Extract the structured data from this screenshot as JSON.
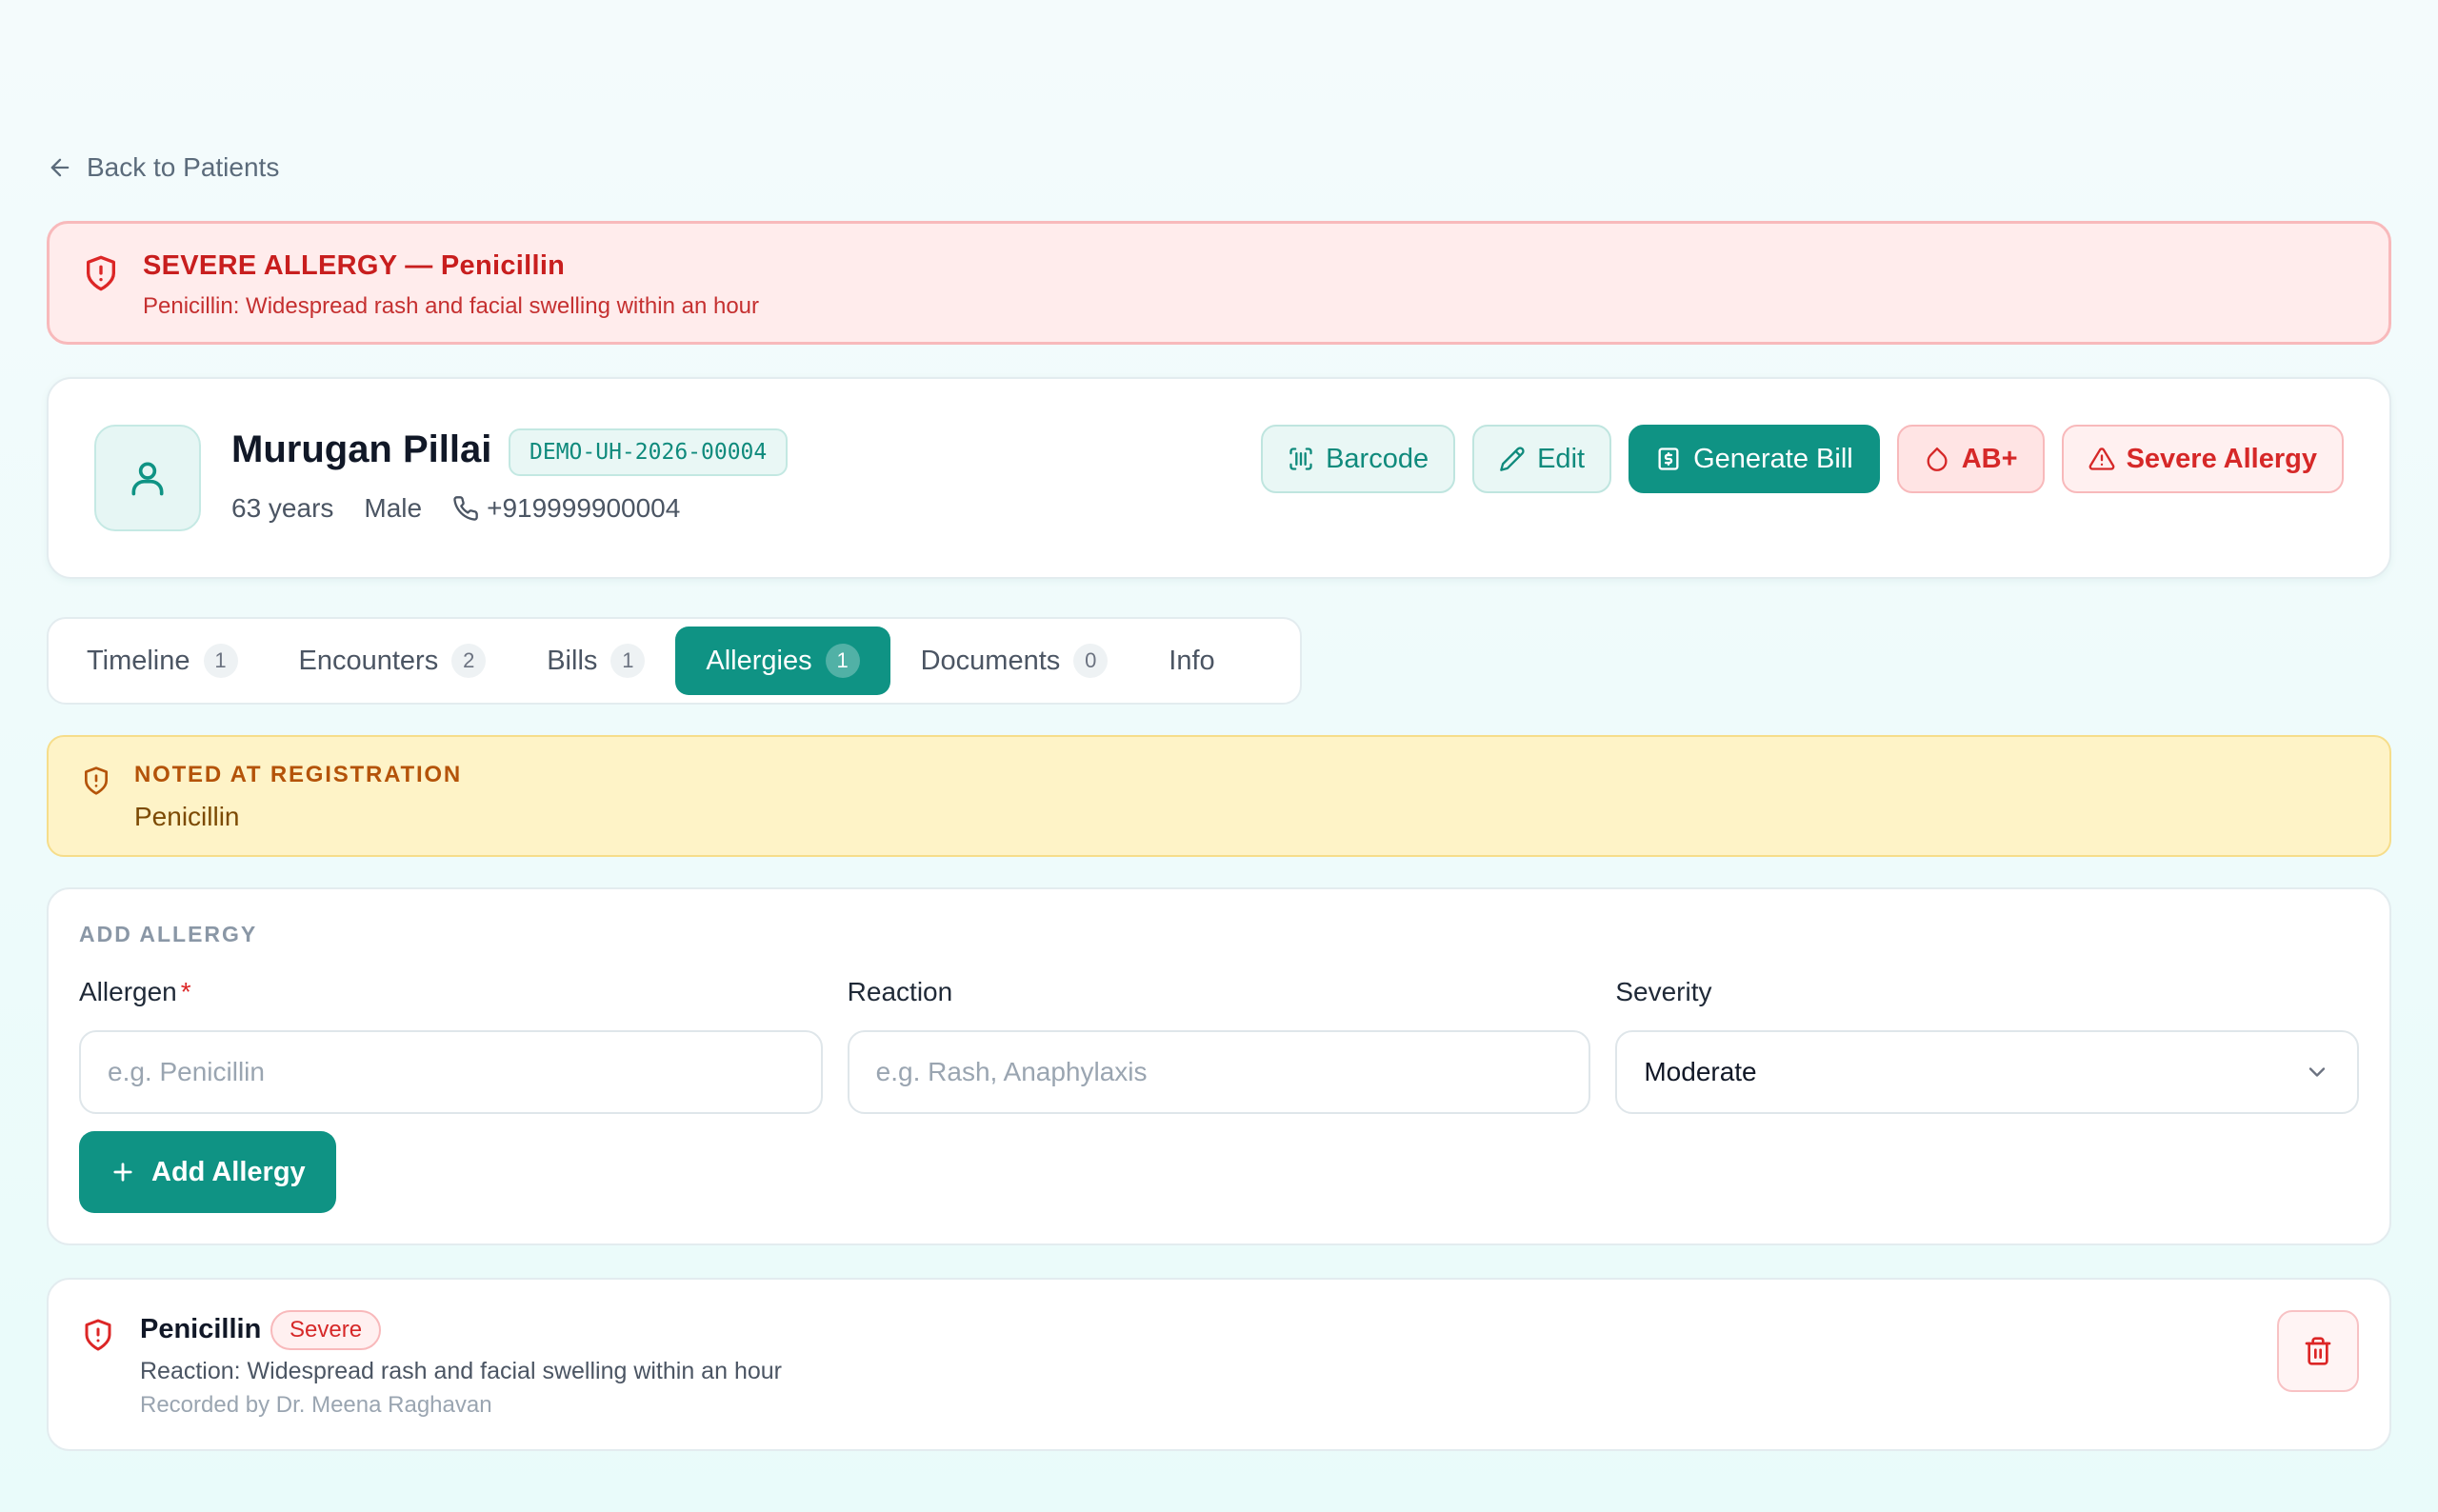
{
  "nav": {
    "back_label": "Back to Patients"
  },
  "alert": {
    "title": "SEVERE ALLERGY — Penicillin",
    "detail": "Penicillin: Widespread rash and facial swelling within an hour"
  },
  "patient": {
    "name": "Murugan Pillai",
    "id": "DEMO-UH-2026-00004",
    "age": "63 years",
    "sex": "Male",
    "phone": "+919999900004"
  },
  "actions": {
    "barcode": "Barcode",
    "edit": "Edit",
    "generate_bill": "Generate Bill",
    "blood_group": "AB+",
    "allergy_flag": "Severe Allergy"
  },
  "tabs": [
    {
      "label": "Timeline",
      "count": "1"
    },
    {
      "label": "Encounters",
      "count": "2"
    },
    {
      "label": "Bills",
      "count": "1"
    },
    {
      "label": "Allergies",
      "count": "1"
    },
    {
      "label": "Documents",
      "count": "0"
    },
    {
      "label": "Info",
      "count": ""
    }
  ],
  "registration_note": {
    "title": "NOTED AT REGISTRATION",
    "value": "Penicillin"
  },
  "add_allergy": {
    "heading": "ADD ALLERGY",
    "allergen_label": "Allergen",
    "required_mark": "*",
    "allergen_placeholder": "e.g. Penicillin",
    "reaction_label": "Reaction",
    "reaction_placeholder": "e.g. Rash, Anaphylaxis",
    "severity_label": "Severity",
    "severity_value": "Moderate",
    "submit_label": "Add Allergy"
  },
  "allergy_list": [
    {
      "name": "Penicillin",
      "severity": "Severe",
      "reaction": "Reaction: Widespread rash and facial swelling within an hour",
      "recorded_by": "Recorded by Dr. Meena Raghavan"
    }
  ],
  "colors": {
    "primary": "#0f9384",
    "danger": "#dc2626",
    "warning_bg": "#fef3c7",
    "danger_bg": "#ffecec"
  }
}
